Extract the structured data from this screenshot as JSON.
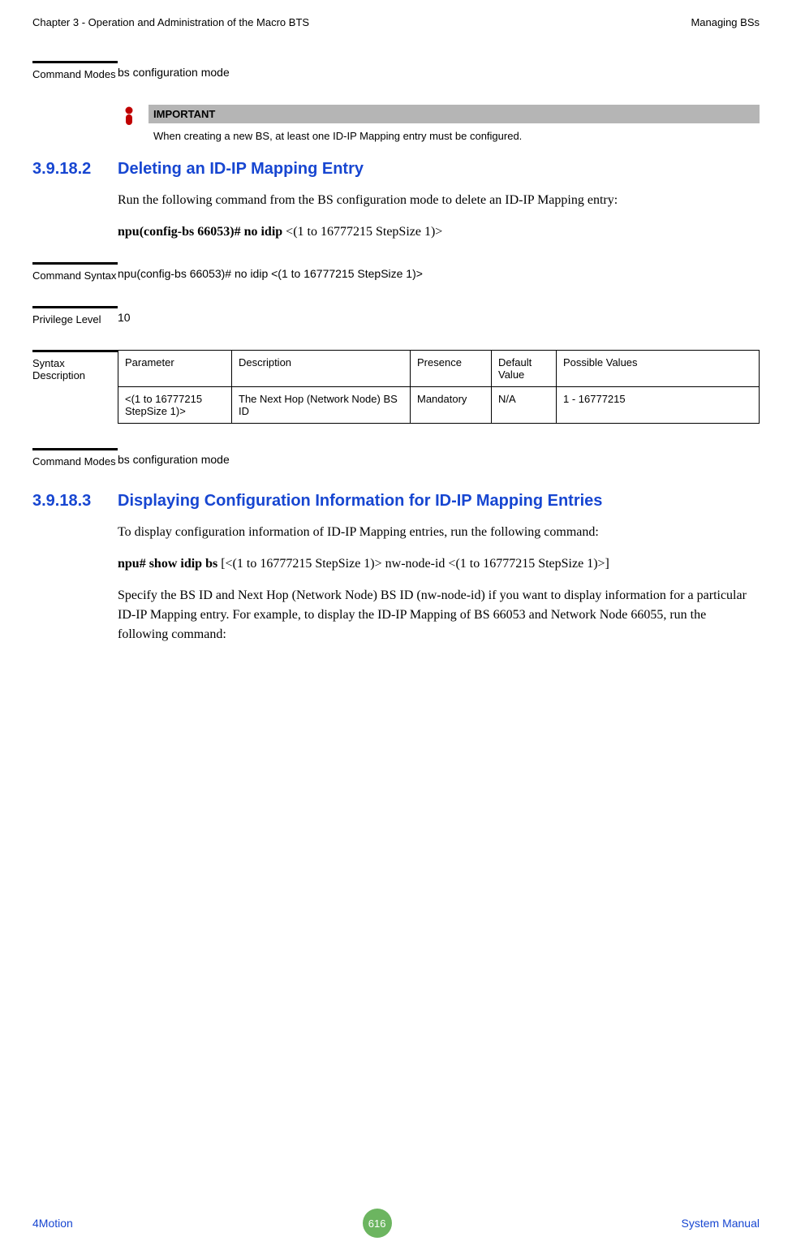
{
  "header": {
    "left": "Chapter 3 - Operation and Administration of the Macro BTS",
    "right": "Managing BSs"
  },
  "commandModes1": {
    "label": "Command Modes",
    "value": "bs configuration mode"
  },
  "important": {
    "header": "IMPORTANT",
    "text": "When creating a new BS, at least one ID-IP Mapping entry must be configured."
  },
  "section2": {
    "number": "3.9.18.2",
    "title": "Deleting an ID-IP Mapping Entry",
    "intro": "Run the following command from the BS configuration mode to delete an ID-IP Mapping entry:",
    "cmdBold": "npu(config-bs 66053)# no idip ",
    "cmdRest": "<(1 to 16777215 StepSize 1)>"
  },
  "commandSyntax": {
    "label": "Command Syntax",
    "value": "npu(config-bs 66053)# no idip <(1 to 16777215 StepSize 1)>"
  },
  "privilegeLevel": {
    "label": "Privilege Level",
    "value": "10"
  },
  "syntaxDescription": {
    "label": "Syntax Description",
    "headers": {
      "parameter": "Parameter",
      "description": "Description",
      "presence": "Presence",
      "defaultValue": "Default Value",
      "possibleValues": "Possible Values"
    },
    "row": {
      "parameter": "<(1 to 16777215 StepSize 1)>",
      "description": "The Next Hop (Network Node) BS ID",
      "presence": "Mandatory",
      "defaultValue": "N/A",
      "possibleValues": "1 - 16777215"
    }
  },
  "commandModes2": {
    "label": "Command Modes",
    "value": "bs configuration mode"
  },
  "section3": {
    "number": "3.9.18.3",
    "title": "Displaying Configuration Information for ID-IP Mapping Entries",
    "intro": "To display configuration information of ID-IP Mapping entries, run the following command:",
    "cmdBold": "npu# show idip bs ",
    "cmdRest": "[<(1 to 16777215 StepSize 1)> nw-node-id <(1 to 16777215 StepSize 1)>]",
    "para2": "Specify the BS ID and Next Hop (Network Node) BS ID (nw-node-id) if you want to display information for a particular ID-IP Mapping entry. For example, to display the ID-IP Mapping of BS 66053 and Network Node 66055, run the following command:"
  },
  "footer": {
    "left": "4Motion",
    "page": "616",
    "right": "System Manual"
  }
}
